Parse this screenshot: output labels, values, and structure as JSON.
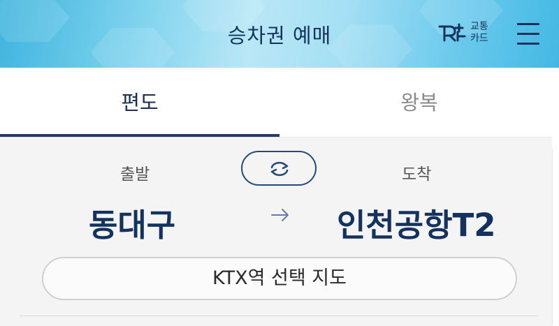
{
  "header": {
    "title": "승차권 예매",
    "card_logo_line1": "교통",
    "card_logo_line2": "카드",
    "card_logo_icon": "rail-plus-logo-icon",
    "menu_icon": "hamburger-menu-icon"
  },
  "tabs": [
    {
      "label": "편도",
      "active": true
    },
    {
      "label": "왕복",
      "active": false
    }
  ],
  "route": {
    "departure_label": "출발",
    "arrival_label": "도착",
    "departure_station": "동대구",
    "arrival_station": "인천공항T2",
    "swap_icon": "swap-arrows-icon",
    "direction_icon": "arrow-right-icon"
  },
  "map_button": {
    "label": "KTX역 선택 지도"
  },
  "colors": {
    "navy": "#14325e",
    "header_gradient_start": "#3fb4de",
    "header_gradient_mid": "#b9e7f6",
    "inactive_tab": "#8a8a8a",
    "panel_bg": "#f4f4f4"
  }
}
